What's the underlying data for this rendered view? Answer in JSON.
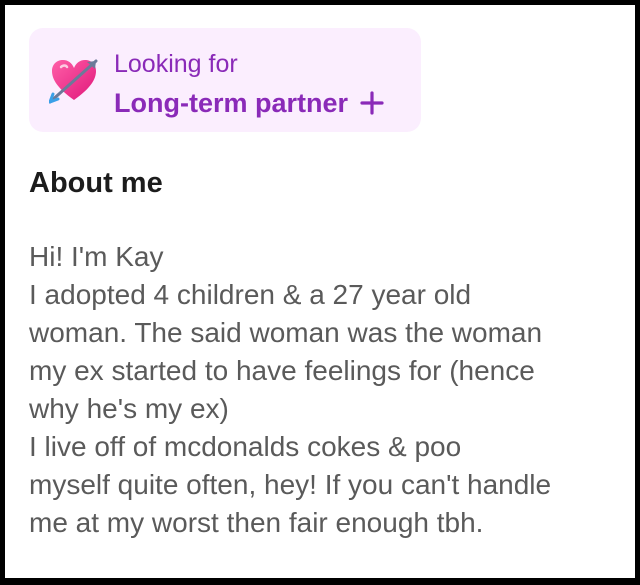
{
  "looking_for": {
    "heading": "Looking for",
    "value": "Long-term partner",
    "icon": "heart-with-arrow-icon",
    "add_icon": "plus-icon",
    "accent_color": "#8a2ab8",
    "chip_background": "#fbeefe"
  },
  "about": {
    "title": "About me",
    "bio_lines": [
      "Hi! I'm Kay",
      "I adopted 4 children & a 27 year old",
      "woman. The said woman was the woman",
      "my ex started to have feelings for (hence",
      "why he's my ex)",
      "I live off of mcdonalds cokes & poo",
      "myself quite often, hey! If you can't handle",
      "me at my worst then fair enough tbh."
    ]
  }
}
